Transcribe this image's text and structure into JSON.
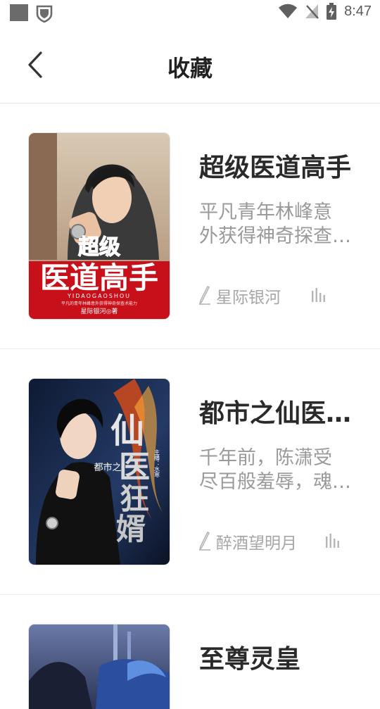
{
  "status_bar": {
    "time": "8:47",
    "icons": [
      "notification-square-icon",
      "shield-icon",
      "wifi-icon",
      "no-signal-icon",
      "battery-charging-icon"
    ]
  },
  "header": {
    "title": "收藏",
    "back_icon": "chevron-left-icon"
  },
  "books": [
    {
      "title": "超级医道高手",
      "desc_line1": "平凡青年林峰意",
      "desc_line2": "外获得神奇探查…",
      "author": "星际银河",
      "cover_title": "超级医道高手",
      "cover_pinyin": "YIDAOGAOSHOU",
      "cover_author": "星际银河◎著",
      "cover_tagline": "平凡的青年林峰意外获得神奇探查术能力"
    },
    {
      "title": "都市之仙医…",
      "desc_line1": "千年前，陈潇受",
      "desc_line2": "尽百般羞辱，魂…",
      "author": "醉酒望明月",
      "cover_title": "都市之仙医狂婿",
      "cover_sub": "都市之",
      "cover_credit": "主播：水寒 作者：红玉如冰"
    },
    {
      "title": "至尊灵皇"
    }
  ],
  "colors": {
    "cover1_banner": "#c8101a",
    "cover2_bg": "#1a2a4a",
    "cover3_bg": "#4a5a88"
  }
}
